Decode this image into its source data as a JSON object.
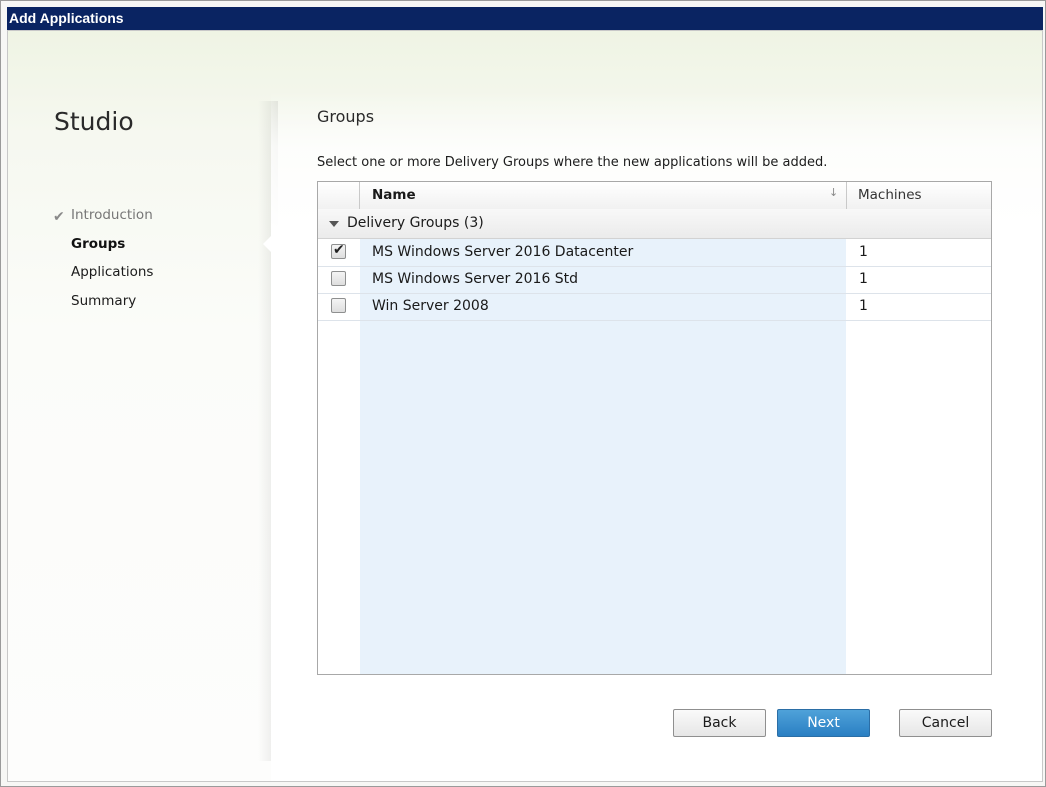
{
  "window": {
    "title": "Add Applications"
  },
  "nav": {
    "studio_label": "Studio",
    "items": [
      {
        "label": "Introduction",
        "state": "done"
      },
      {
        "label": "Groups",
        "state": "active"
      },
      {
        "label": "Applications",
        "state": "pending"
      },
      {
        "label": "Summary",
        "state": "pending"
      }
    ]
  },
  "main": {
    "heading": "Groups",
    "instruction": "Select one or more Delivery Groups where the new applications will be added.",
    "table": {
      "columns": {
        "name": "Name",
        "machines": "Machines"
      },
      "group": {
        "label": "Delivery Groups (3)",
        "expanded": true
      },
      "rows": [
        {
          "name": "MS Windows Server 2016 Datacenter",
          "machines": "1",
          "checked": true
        },
        {
          "name": "MS Windows Server 2016 Std",
          "machines": "1",
          "checked": false
        },
        {
          "name": "Win Server 2008",
          "machines": "1",
          "checked": false
        }
      ]
    }
  },
  "buttons": {
    "back": "Back",
    "next": "Next",
    "cancel": "Cancel"
  },
  "colors": {
    "titlebar": "#0a2462",
    "primary_button": "#2a7fc3",
    "selection_column": "#e8f2fb"
  }
}
